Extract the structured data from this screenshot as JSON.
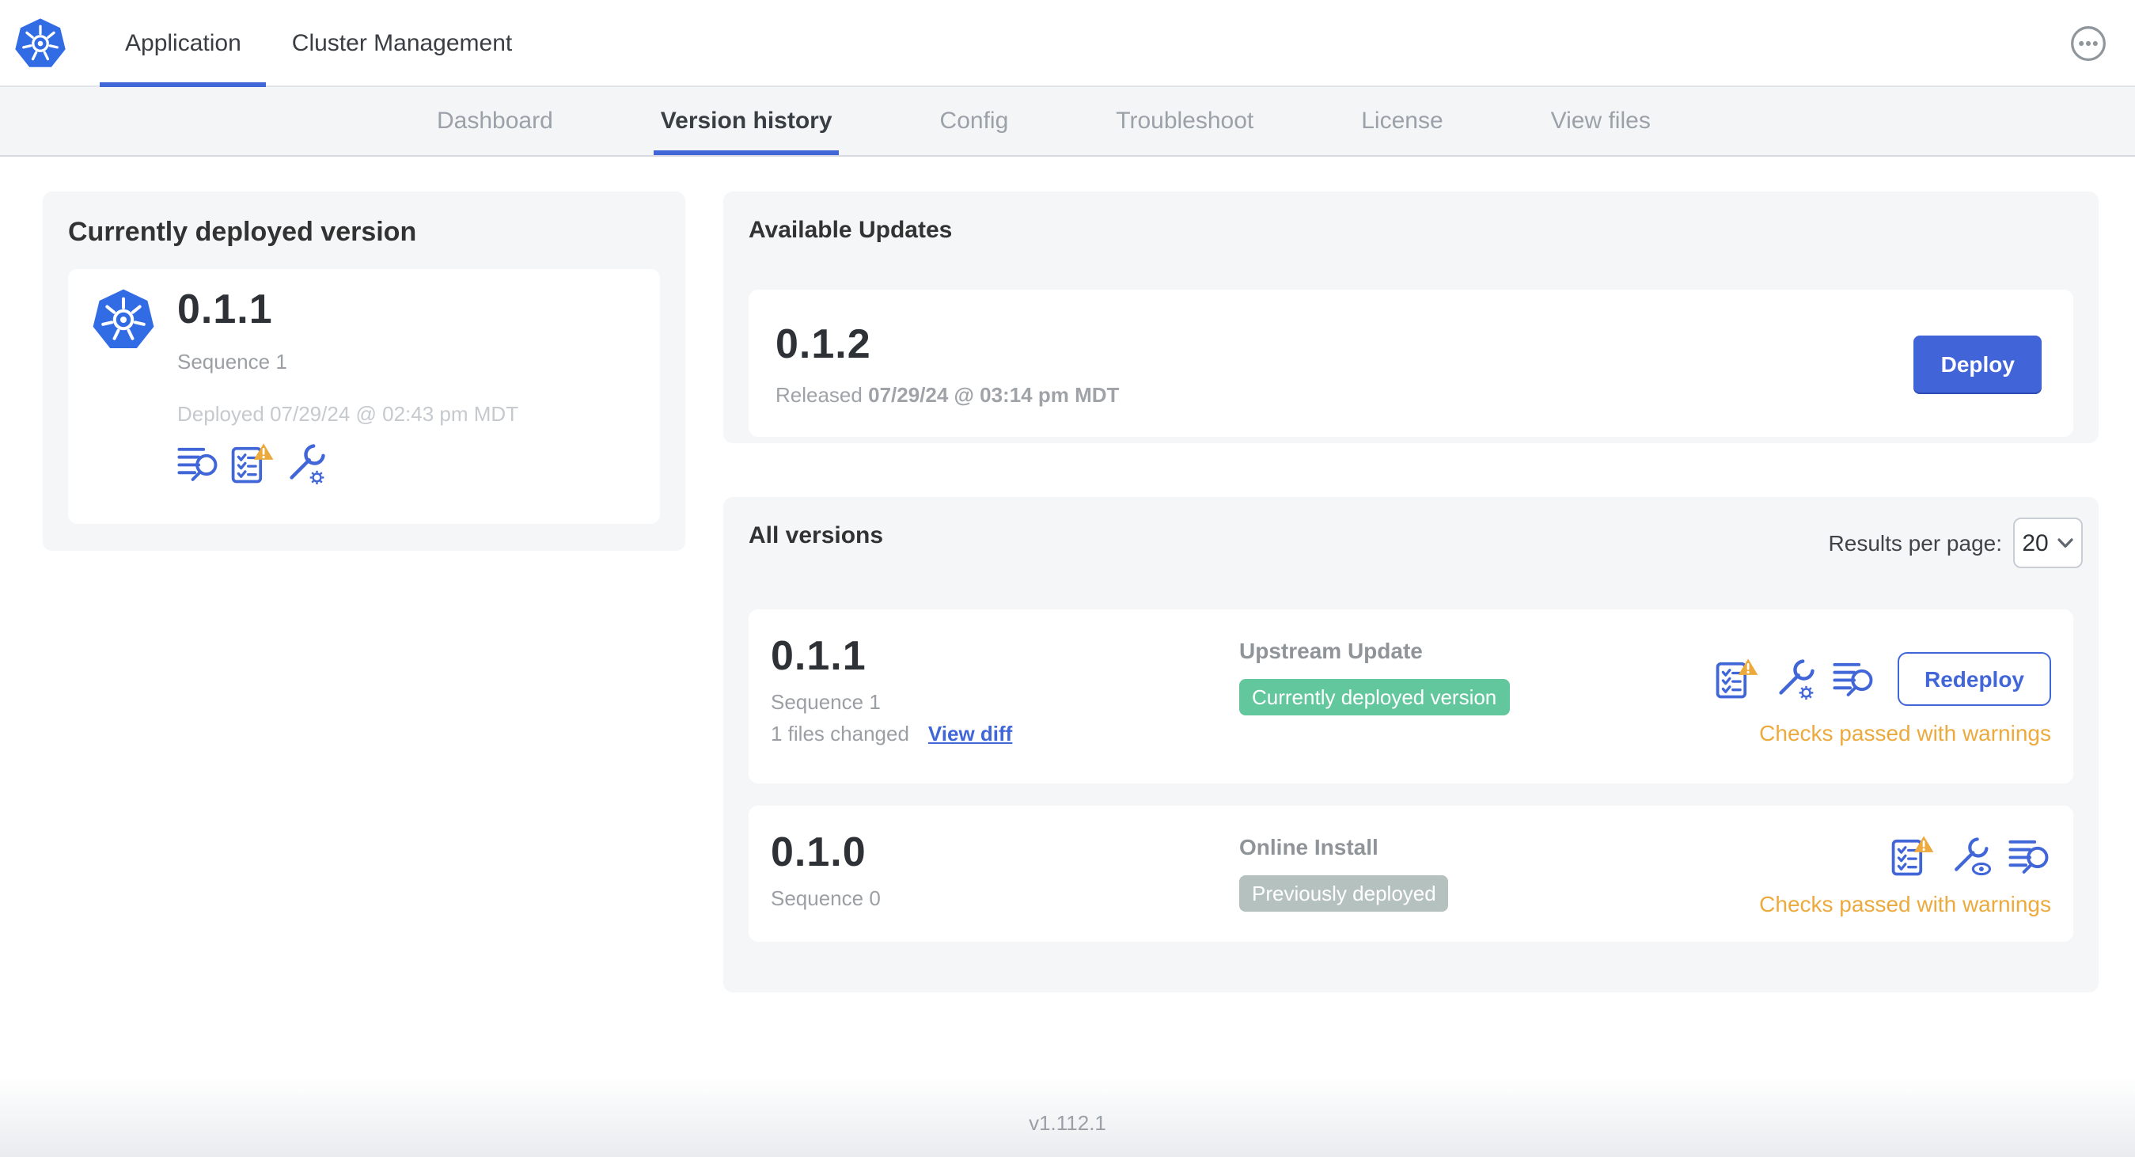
{
  "header": {
    "tabs": [
      {
        "label": "Application",
        "active": true
      },
      {
        "label": "Cluster Management",
        "active": false
      }
    ]
  },
  "subnav": {
    "tabs": [
      {
        "label": "Dashboard",
        "active": false
      },
      {
        "label": "Version history",
        "active": true
      },
      {
        "label": "Config",
        "active": false
      },
      {
        "label": "Troubleshoot",
        "active": false
      },
      {
        "label": "License",
        "active": false
      },
      {
        "label": "View files",
        "active": false
      }
    ]
  },
  "current_version_card": {
    "title": "Currently deployed version",
    "version": "0.1.1",
    "sequence": "Sequence 1",
    "deployed": "Deployed 07/29/24 @ 02:43 pm MDT"
  },
  "available_updates": {
    "title": "Available Updates",
    "version": "0.1.2",
    "released_prefix": "Released",
    "released_date": "07/29/24 @ 03:14 pm MDT",
    "deploy_label": "Deploy"
  },
  "all_versions": {
    "title": "All versions",
    "results_per_page_label": "Results per page:",
    "results_per_page_value": "20",
    "rows": [
      {
        "version": "0.1.1",
        "sequence": "Sequence 1",
        "files_changed": "1 files changed",
        "view_diff_label": "View diff",
        "source": "Upstream Update",
        "badge": "Currently deployed version",
        "checks": "Checks passed with warnings",
        "action_label": "Redeploy"
      },
      {
        "version": "0.1.0",
        "sequence": "Sequence 0",
        "source": "Online Install",
        "badge": "Previously deployed",
        "checks": "Checks passed with warnings"
      }
    ]
  },
  "footer": {
    "app_version": "v1.112.1"
  },
  "colors": {
    "accent_blue": "#4166d8",
    "k8s_logo_blue": "#326ce5",
    "badge_green": "#62c79c",
    "badge_gray": "#b5c1be",
    "warning_orange": "#edaa3c",
    "card_background": "#f5f6f8"
  }
}
